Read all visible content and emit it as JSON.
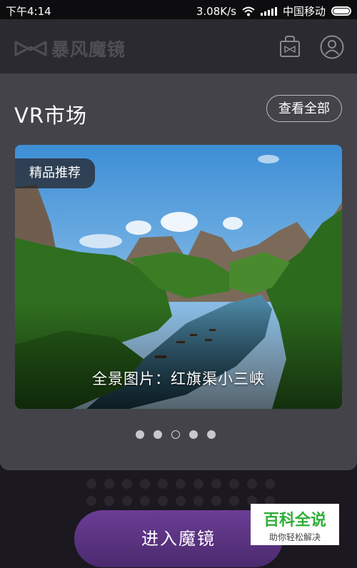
{
  "status_bar": {
    "time": "下午4:14",
    "speed": "3.08K/s",
    "carrier": "中国移动"
  },
  "header": {
    "brand": "暴风魔镜",
    "icons": [
      "logo-icon",
      "store-icon",
      "user-icon"
    ]
  },
  "market": {
    "title": "VR市场",
    "view_all_label": "查看全部",
    "banner": {
      "tag": "精品推荐",
      "caption": "全景图片：红旗渠小三峡"
    },
    "pager": {
      "count": 5,
      "active_index": 2
    }
  },
  "bottom": {
    "enter_label": "进入魔镜"
  },
  "watermark": {
    "title": "百科全说",
    "subtitle": "助你轻松解决"
  },
  "colors": {
    "accent": "#5e3587",
    "panel": "#444349",
    "header": "#2c2a31"
  }
}
